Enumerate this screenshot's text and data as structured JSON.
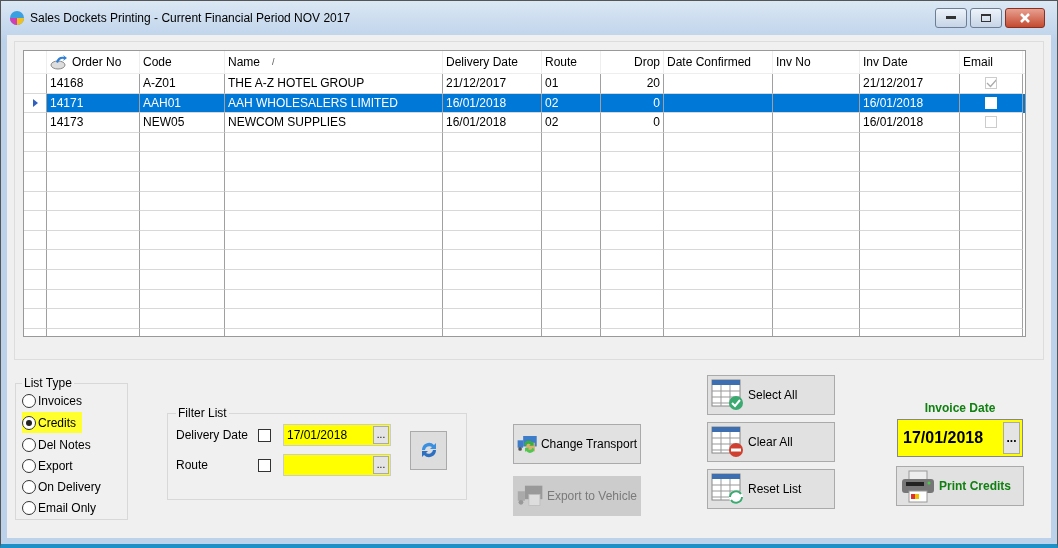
{
  "window": {
    "title": "Sales Dockets Printing - Current Financial Period NOV 2017"
  },
  "table": {
    "columns": [
      "Order No",
      "Code",
      "Name",
      "Delivery Date",
      "Route",
      "Drop",
      "Date Confirmed",
      "Inv No",
      "Inv Date",
      "Email"
    ],
    "sort_mark": "/",
    "rows": [
      {
        "order_no": "14168",
        "code": "A-Z01",
        "name": "THE A-Z HOTEL GROUP",
        "delivery_date": "21/12/2017",
        "route": "01",
        "drop": "20",
        "inv_date": "21/12/2017",
        "email": true,
        "selected": false
      },
      {
        "order_no": "14171",
        "code": "AAH01",
        "name": "AAH  WHOLESALERS LIMITED",
        "delivery_date": "16/01/2018",
        "route": "02",
        "drop": "0",
        "inv_date": "16/01/2018",
        "email": false,
        "selected": true
      },
      {
        "order_no": "14173",
        "code": "NEW05",
        "name": "NEWCOM SUPPLIES",
        "delivery_date": "16/01/2018",
        "route": "02",
        "drop": "0",
        "inv_date": "16/01/2018",
        "email": false,
        "selected": false
      }
    ]
  },
  "list_type": {
    "title": "List Type",
    "options": [
      {
        "label": "Invoices",
        "selected": false
      },
      {
        "label": "Credits",
        "selected": true
      },
      {
        "label": "Del Notes",
        "selected": false
      },
      {
        "label": "Export",
        "selected": false
      },
      {
        "label": "On Delivery",
        "selected": false
      },
      {
        "label": "Email Only",
        "selected": false
      }
    ]
  },
  "filter_list": {
    "title": "Filter List",
    "filters": [
      {
        "label": "Delivery Date",
        "checked": false,
        "value": "17/01/2018",
        "button": "..."
      },
      {
        "label": "Route",
        "checked": false,
        "button": "..."
      }
    ]
  },
  "buttons": [
    {
      "kind": "transport",
      "label": "Change Transport",
      "disabled": false
    },
    {
      "kind": "export",
      "label": "Export to Vehicle",
      "disabled": true
    }
  ],
  "selection_buttons": [
    {
      "kind": "select",
      "label": "Select All"
    },
    {
      "kind": "clear",
      "label": "Clear All"
    },
    {
      "kind": "reset",
      "label": "Reset List"
    }
  ],
  "invoice_date": {
    "label": "Invoice Date",
    "value": "17/01/2018",
    "button": "..."
  },
  "print_button": {
    "label": "Print Credits"
  }
}
